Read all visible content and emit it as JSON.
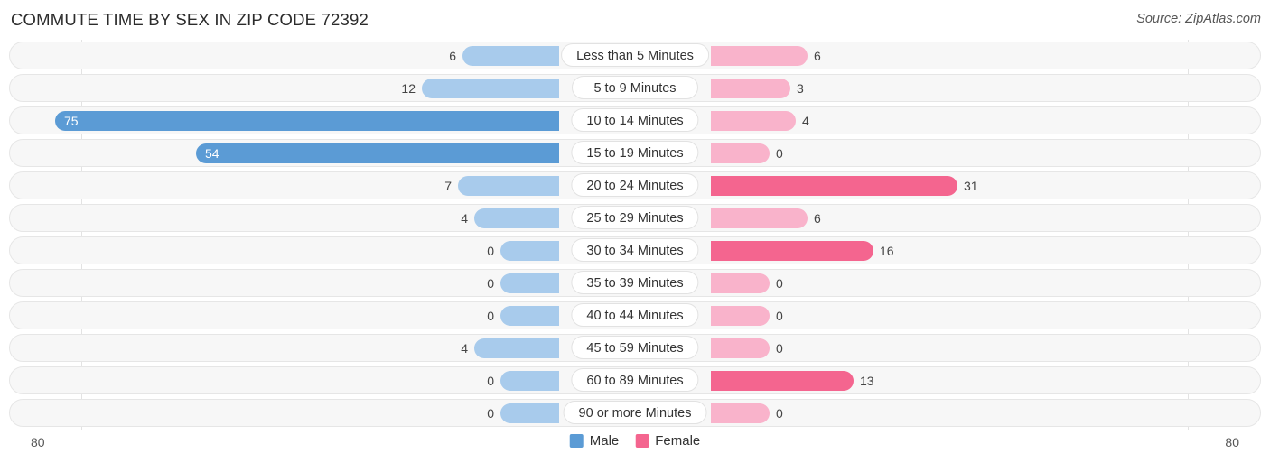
{
  "header": {
    "title": "COMMUTE TIME BY SEX IN ZIP CODE 72392",
    "source": "Source: ZipAtlas.com"
  },
  "axis": {
    "left_end": "80",
    "right_end": "80"
  },
  "legend": {
    "male_label": "Male",
    "female_label": "Female",
    "male_color": "#5b9bd5",
    "female_color": "#f4658f"
  },
  "colors": {
    "male_light": "#a8cbec",
    "male_dark": "#5b9bd5",
    "female_light": "#f9b3cb",
    "female_dark": "#f4658f",
    "track": "#f7f7f7"
  },
  "chart_data": {
    "type": "bar",
    "title": "COMMUTE TIME BY SEX IN ZIP CODE 72392",
    "subtitle": "Source: ZipAtlas.com",
    "orientation": "horizontal-diverging",
    "xlabel": "",
    "ylabel": "",
    "xlim": [
      80,
      80
    ],
    "axis_left_max": 80,
    "axis_right_max": 80,
    "grid": false,
    "legend_position": "bottom-center",
    "categories": [
      "Less than 5 Minutes",
      "5 to 9 Minutes",
      "10 to 14 Minutes",
      "15 to 19 Minutes",
      "20 to 24 Minutes",
      "25 to 29 Minutes",
      "30 to 34 Minutes",
      "35 to 39 Minutes",
      "40 to 44 Minutes",
      "45 to 59 Minutes",
      "60 to 89 Minutes",
      "90 or more Minutes"
    ],
    "series": [
      {
        "name": "Male",
        "side": "left",
        "values": [
          6,
          12,
          75,
          54,
          7,
          4,
          0,
          0,
          0,
          4,
          0,
          0
        ]
      },
      {
        "name": "Female",
        "side": "right",
        "values": [
          6,
          3,
          4,
          0,
          31,
          6,
          16,
          0,
          0,
          0,
          13,
          0
        ]
      }
    ]
  },
  "rows": [
    {
      "category": "Less than 5 Minutes",
      "male": "6",
      "female": "6",
      "male_w": 107,
      "female_w": 107,
      "male_hi": false,
      "female_hi": false,
      "male_inside": false,
      "female_inside": false
    },
    {
      "category": "5 to 9 Minutes",
      "male": "12",
      "female": "3",
      "male_w": 152,
      "female_w": 88,
      "male_hi": false,
      "female_hi": false,
      "male_inside": false,
      "female_inside": false
    },
    {
      "category": "10 to 14 Minutes",
      "male": "75",
      "female": "4",
      "male_w": 558,
      "female_w": 94,
      "male_hi": true,
      "female_hi": false,
      "male_inside": true,
      "female_inside": false
    },
    {
      "category": "15 to 19 Minutes",
      "male": "54",
      "female": "0",
      "male_w": 402,
      "female_w": 65,
      "male_hi": true,
      "female_hi": false,
      "male_inside": true,
      "female_inside": false
    },
    {
      "category": "20 to 24 Minutes",
      "male": "7",
      "female": "31",
      "male_w": 112,
      "female_w": 273,
      "male_hi": false,
      "female_hi": true,
      "male_inside": false,
      "female_inside": false
    },
    {
      "category": "25 to 29 Minutes",
      "male": "4",
      "female": "6",
      "male_w": 94,
      "female_w": 107,
      "male_hi": false,
      "female_hi": false,
      "male_inside": false,
      "female_inside": false
    },
    {
      "category": "30 to 34 Minutes",
      "male": "0",
      "female": "16",
      "male_w": 65,
      "female_w": 180,
      "male_hi": false,
      "female_hi": true,
      "male_inside": false,
      "female_inside": false
    },
    {
      "category": "35 to 39 Minutes",
      "male": "0",
      "female": "0",
      "male_w": 65,
      "female_w": 65,
      "male_hi": false,
      "female_hi": false,
      "male_inside": false,
      "female_inside": false
    },
    {
      "category": "40 to 44 Minutes",
      "male": "0",
      "female": "0",
      "male_w": 65,
      "female_w": 65,
      "male_hi": false,
      "female_hi": false,
      "male_inside": false,
      "female_inside": false
    },
    {
      "category": "45 to 59 Minutes",
      "male": "4",
      "female": "0",
      "male_w": 94,
      "female_w": 65,
      "male_hi": false,
      "female_hi": false,
      "male_inside": false,
      "female_inside": false
    },
    {
      "category": "60 to 89 Minutes",
      "male": "0",
      "female": "13",
      "male_w": 65,
      "female_w": 158,
      "male_hi": false,
      "female_hi": true,
      "male_inside": false,
      "female_inside": false
    },
    {
      "category": "90 or more Minutes",
      "male": "0",
      "female": "0",
      "male_w": 65,
      "female_w": 65,
      "male_hi": false,
      "female_hi": false,
      "male_inside": false,
      "female_inside": false
    }
  ]
}
